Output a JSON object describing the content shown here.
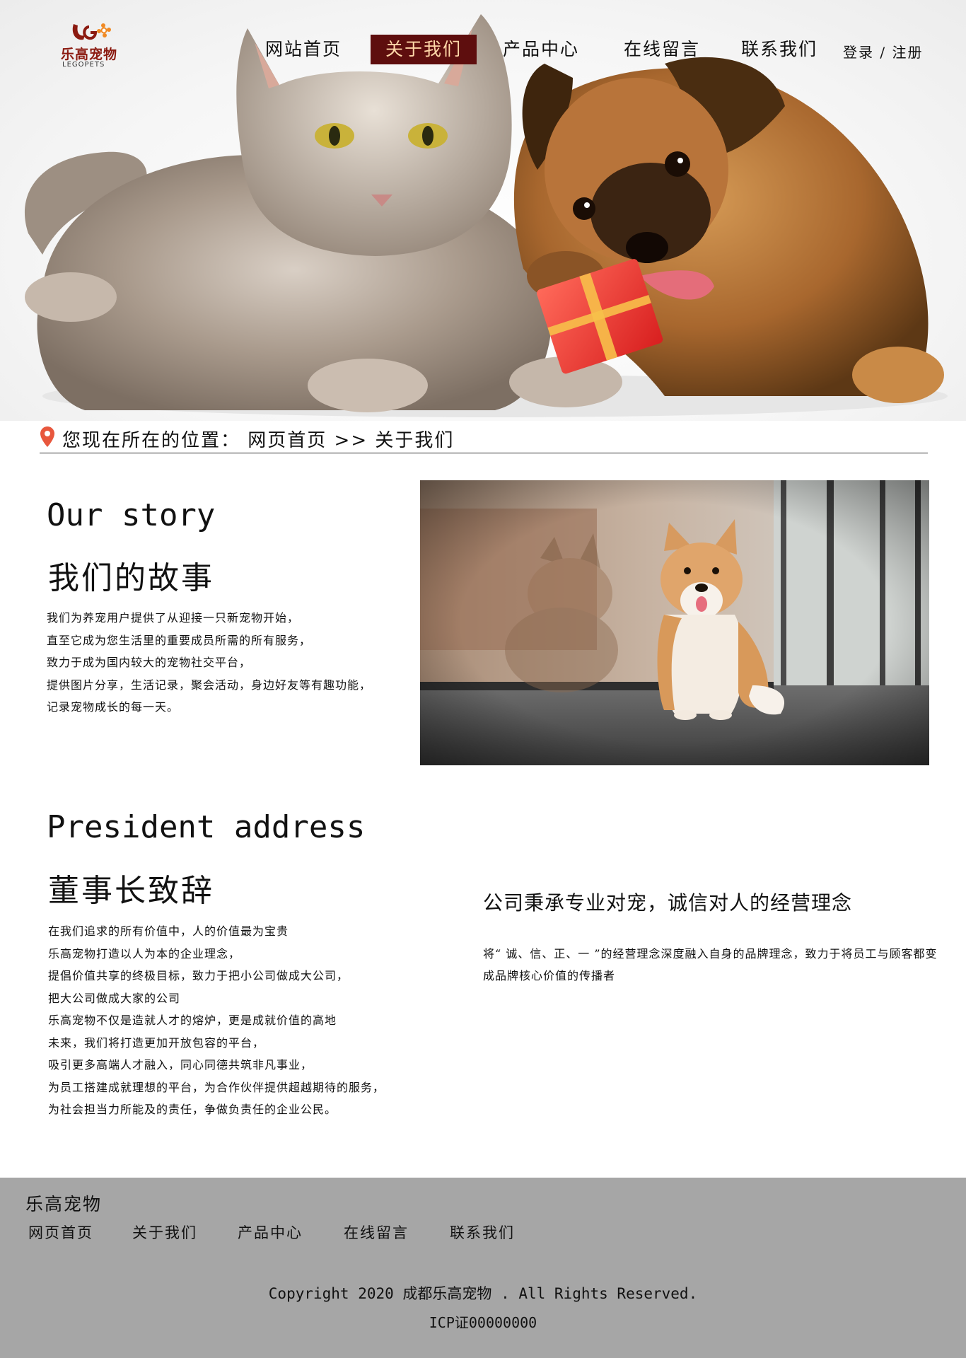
{
  "brand": {
    "logo_cn": "乐高宠物",
    "logo_en": "LEGOPETS",
    "logo_colors": [
      "#8b1a10",
      "#f08a24"
    ]
  },
  "nav": {
    "items": [
      {
        "label": "网站首页",
        "active": false
      },
      {
        "label": "关于我们",
        "active": true
      },
      {
        "label": "产品中心",
        "active": false
      },
      {
        "label": "在线留言",
        "active": false
      },
      {
        "label": "联系我们",
        "active": false
      }
    ],
    "login": "登录 / 注册",
    "active_bg": "#5e0e0e",
    "active_fg": "#ffd7a8"
  },
  "breadcrumb": {
    "text": "您现在所在的位置： 网页首页 >> 关于我们",
    "icon": "location-pin-icon",
    "icon_color": "#e8573d"
  },
  "story": {
    "title_en": "Our story",
    "title_cn": "我们的故事",
    "lines": [
      "我们为养宠用户提供了从迎接一只新宠物开始，",
      "直至它成为您生活里的重要成员所需的所有服务，",
      "致力于成为国内较大的宠物社交平台，",
      "提供图片分享，生活记录，聚会活动，身边好友等有趣功能，",
      "记录宠物成长的每一天。"
    ]
  },
  "president": {
    "title_en": "President address",
    "title_cn": "董事长致辞",
    "lines": [
      "在我们追求的所有价值中，人的价值最为宝贵",
      "乐高宠物打造以人为本的企业理念，",
      "提倡价值共享的终极目标，致力于把小公司做成大公司，",
      "把大公司做成大家的公司",
      "乐高宠物不仅是造就人才的熔炉，更是成就价值的高地",
      "未来，我们将打造更加开放包容的平台，",
      "吸引更多高端人才融入，同心同德共筑非凡事业，",
      "为员工搭建成就理想的平台，为合作伙伴提供超越期待的服务，",
      "为社会担当力所能及的责任，争做负责任的企业公民。"
    ],
    "motto": "公司秉承专业对宠，诚信对人的经营理念",
    "motto_text": "将“ 诚、信、正、一 ”的经营理念深度融入自身的品牌理念，致力于将员工与顾客都变成品牌核心价值的传播者"
  },
  "footer": {
    "brand": "乐高宠物",
    "links": [
      "网页首页",
      "关于我们",
      "产品中心",
      "在线留言",
      "联系我们"
    ],
    "copyright": "Copyright 2020 成都乐高宠物 . All Rights Reserved.",
    "icp": "ICP证00000000",
    "bg": "#a6a6a6"
  }
}
